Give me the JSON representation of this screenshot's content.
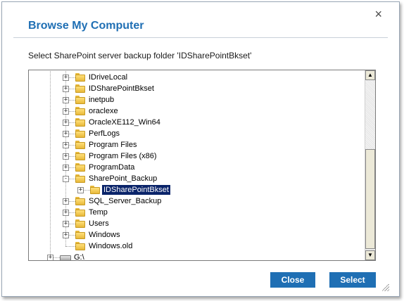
{
  "dialog": {
    "title": "Browse My Computer",
    "close_glyph": "×",
    "instruction": "Select SharePoint server backup folder 'IDSharePointBkset'"
  },
  "tree": {
    "items": [
      {
        "label": "IDriveLocal",
        "expander": "+"
      },
      {
        "label": "IDSharePointBkset",
        "expander": "+"
      },
      {
        "label": "inetpub",
        "expander": "+"
      },
      {
        "label": "oraclexe",
        "expander": "+"
      },
      {
        "label": "OracleXE112_Win64",
        "expander": "+"
      },
      {
        "label": "PerfLogs",
        "expander": "+"
      },
      {
        "label": "Program Files",
        "expander": "+"
      },
      {
        "label": "Program Files (x86)",
        "expander": "+"
      },
      {
        "label": "ProgramData",
        "expander": "+"
      },
      {
        "label": "SharePoint_Backup",
        "expander": "-"
      },
      {
        "label": "IDSharePointBkset",
        "expander": "+",
        "selected": true
      },
      {
        "label": "SQL_Server_Backup",
        "expander": "+"
      },
      {
        "label": "Temp",
        "expander": "+"
      },
      {
        "label": "Users",
        "expander": "+"
      },
      {
        "label": "Windows",
        "expander": "+"
      },
      {
        "label": "Windows.old",
        "expander": ""
      },
      {
        "label": "G:\\",
        "expander": "+"
      }
    ],
    "scroll_up_glyph": "▲",
    "scroll_down_glyph": "▼"
  },
  "footer": {
    "close_label": "Close",
    "select_label": "Select"
  },
  "colors": {
    "title": "#1f6fb4",
    "button": "#1f6fb4",
    "selection": "#0a246a"
  }
}
